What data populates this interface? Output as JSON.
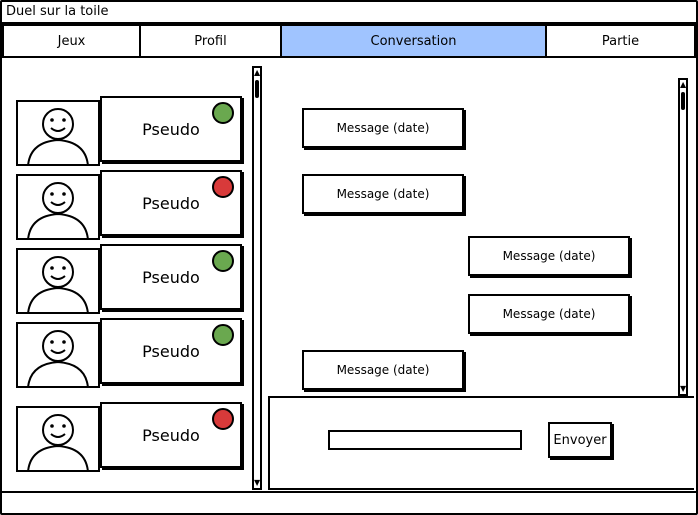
{
  "window": {
    "title": "Duel sur la toile"
  },
  "tabs": [
    {
      "label": "Jeux",
      "active": false
    },
    {
      "label": "Profil",
      "active": false
    },
    {
      "label": "Conversation",
      "active": true
    },
    {
      "label": "Partie",
      "active": false
    }
  ],
  "contacts": [
    {
      "name": "Pseudo",
      "status": "online"
    },
    {
      "name": "Pseudo",
      "status": "offline"
    },
    {
      "name": "Pseudo",
      "status": "online"
    },
    {
      "name": "Pseudo",
      "status": "online"
    },
    {
      "name": "Pseudo",
      "status": "offline"
    }
  ],
  "messages": [
    {
      "text": "Message (date)",
      "side": "left"
    },
    {
      "text": "Message (date)",
      "side": "left"
    },
    {
      "text": "Message (date)",
      "side": "right"
    },
    {
      "text": "Message (date)",
      "side": "right"
    },
    {
      "text": "Message (date)",
      "side": "left"
    }
  ],
  "composer": {
    "input_value": "",
    "send_label": "Envoyer"
  },
  "colors": {
    "active_tab": "#a0c4ff",
    "online": "#6aa84f",
    "offline": "#d83a3a"
  },
  "icons": {
    "avatar": "smiley-avatar-icon",
    "status": "status-dot-icon",
    "scroll_up": "arrow-up-icon",
    "scroll_down": "arrow-down-icon"
  }
}
